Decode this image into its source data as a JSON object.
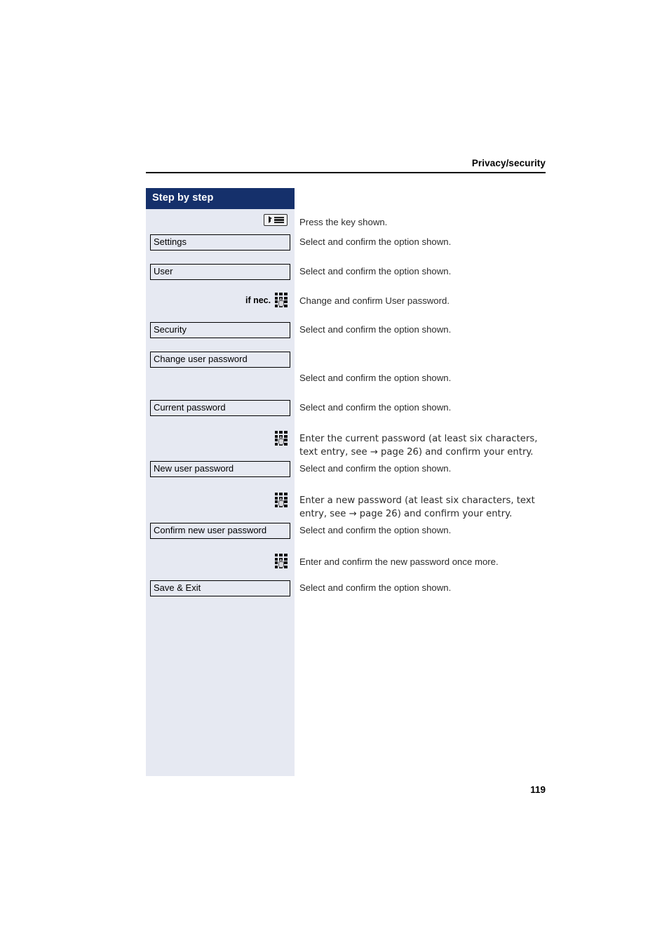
{
  "header": {
    "title": "Privacy/security"
  },
  "sidebar": {
    "title": "Step by step",
    "background_color": "#e6e9f2",
    "title_bar_color": "#15306b"
  },
  "steps": [
    {
      "id": "press-key",
      "icon": "menu-key-icon",
      "prefix": "",
      "menu_label": null,
      "instruction": "Press the key shown."
    },
    {
      "id": "settings",
      "icon": null,
      "prefix": "",
      "menu_label": "Settings",
      "instruction": "Select and confirm the option shown."
    },
    {
      "id": "user",
      "icon": null,
      "prefix": "",
      "menu_label": "User",
      "instruction": "Select and confirm the option shown."
    },
    {
      "id": "user-password",
      "icon": "keypad-icon",
      "prefix": "if nec.",
      "menu_label": null,
      "instruction": "Change and confirm User password."
    },
    {
      "id": "security",
      "icon": null,
      "prefix": "",
      "menu_label": "Security",
      "instruction": "Select and confirm the option shown."
    },
    {
      "id": "change-user-password",
      "icon": null,
      "prefix": "",
      "menu_label": "Change user password",
      "instruction": "Select and confirm the option shown."
    },
    {
      "id": "current-password",
      "icon": null,
      "prefix": "",
      "menu_label": "Current password",
      "instruction": "Select and confirm the option shown."
    },
    {
      "id": "enter-current-password",
      "icon": "keypad-icon",
      "prefix": "",
      "menu_label": null,
      "instruction": "Enter the current password (at least six characters, text entry, see → page 26) and confirm your entry."
    },
    {
      "id": "new-user-password",
      "icon": null,
      "prefix": "",
      "menu_label": "New user password",
      "instruction": "Select and confirm the option shown."
    },
    {
      "id": "enter-new-password",
      "icon": "keypad-icon",
      "prefix": "",
      "menu_label": null,
      "instruction": "Enter a new password (at least six characters, text entry, see → page 26) and confirm your entry."
    },
    {
      "id": "confirm-new-user-password",
      "icon": null,
      "prefix": "",
      "menu_label": "Confirm new user password",
      "instruction": "Select and confirm the option shown."
    },
    {
      "id": "reenter-new-password",
      "icon": "keypad-icon",
      "prefix": "",
      "menu_label": null,
      "instruction": "Enter and confirm the new password once more."
    },
    {
      "id": "save-and-exit",
      "icon": null,
      "prefix": "",
      "menu_label": "Save & Exit",
      "instruction": "Select and confirm the option shown."
    }
  ],
  "footer": {
    "page_number": "119"
  }
}
